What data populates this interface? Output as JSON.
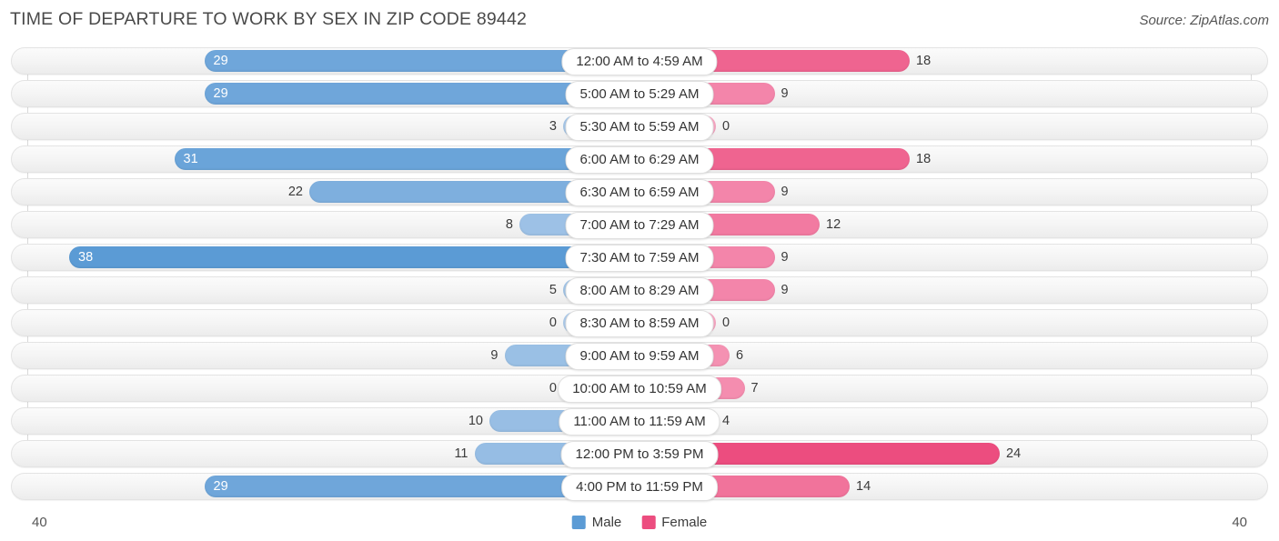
{
  "header": {
    "title": "TIME OF DEPARTURE TO WORK BY SEX IN ZIP CODE 89442",
    "source": "Source: ZipAtlas.com"
  },
  "axis": {
    "left_tick": "40",
    "right_tick": "40"
  },
  "legend": {
    "items": [
      {
        "label": "Male",
        "color": "#5b9bd5"
      },
      {
        "label": "Female",
        "color": "#ec4d7f"
      }
    ]
  },
  "colors": {
    "male_strong": "#5b9bd5",
    "male_weak": "#aecbea",
    "female_strong": "#ec4d7f",
    "female_weak": "#f7a7c3",
    "track": "#f4f4f4",
    "gridline": "#d9d9d9"
  },
  "chart_data": {
    "type": "bar",
    "orientation": "horizontal-diverging",
    "title": "TIME OF DEPARTURE TO WORK BY SEX IN ZIP CODE 89442",
    "xlabel": "",
    "ylabel": "",
    "xlim": [
      40,
      40
    ],
    "axis_max": 40,
    "grid": true,
    "legend_position": "bottom-center",
    "categories": [
      "12:00 AM to 4:59 AM",
      "5:00 AM to 5:29 AM",
      "5:30 AM to 5:59 AM",
      "6:00 AM to 6:29 AM",
      "6:30 AM to 6:59 AM",
      "7:00 AM to 7:29 AM",
      "7:30 AM to 7:59 AM",
      "8:00 AM to 8:29 AM",
      "8:30 AM to 8:59 AM",
      "9:00 AM to 9:59 AM",
      "10:00 AM to 10:59 AM",
      "11:00 AM to 11:59 AM",
      "12:00 PM to 3:59 PM",
      "4:00 PM to 11:59 PM"
    ],
    "series": [
      {
        "name": "Male",
        "values": [
          29,
          29,
          3,
          31,
          22,
          8,
          38,
          5,
          0,
          9,
          0,
          10,
          11,
          29
        ]
      },
      {
        "name": "Female",
        "values": [
          18,
          9,
          0,
          18,
          9,
          12,
          9,
          9,
          0,
          6,
          7,
          4,
          24,
          14
        ]
      }
    ]
  }
}
